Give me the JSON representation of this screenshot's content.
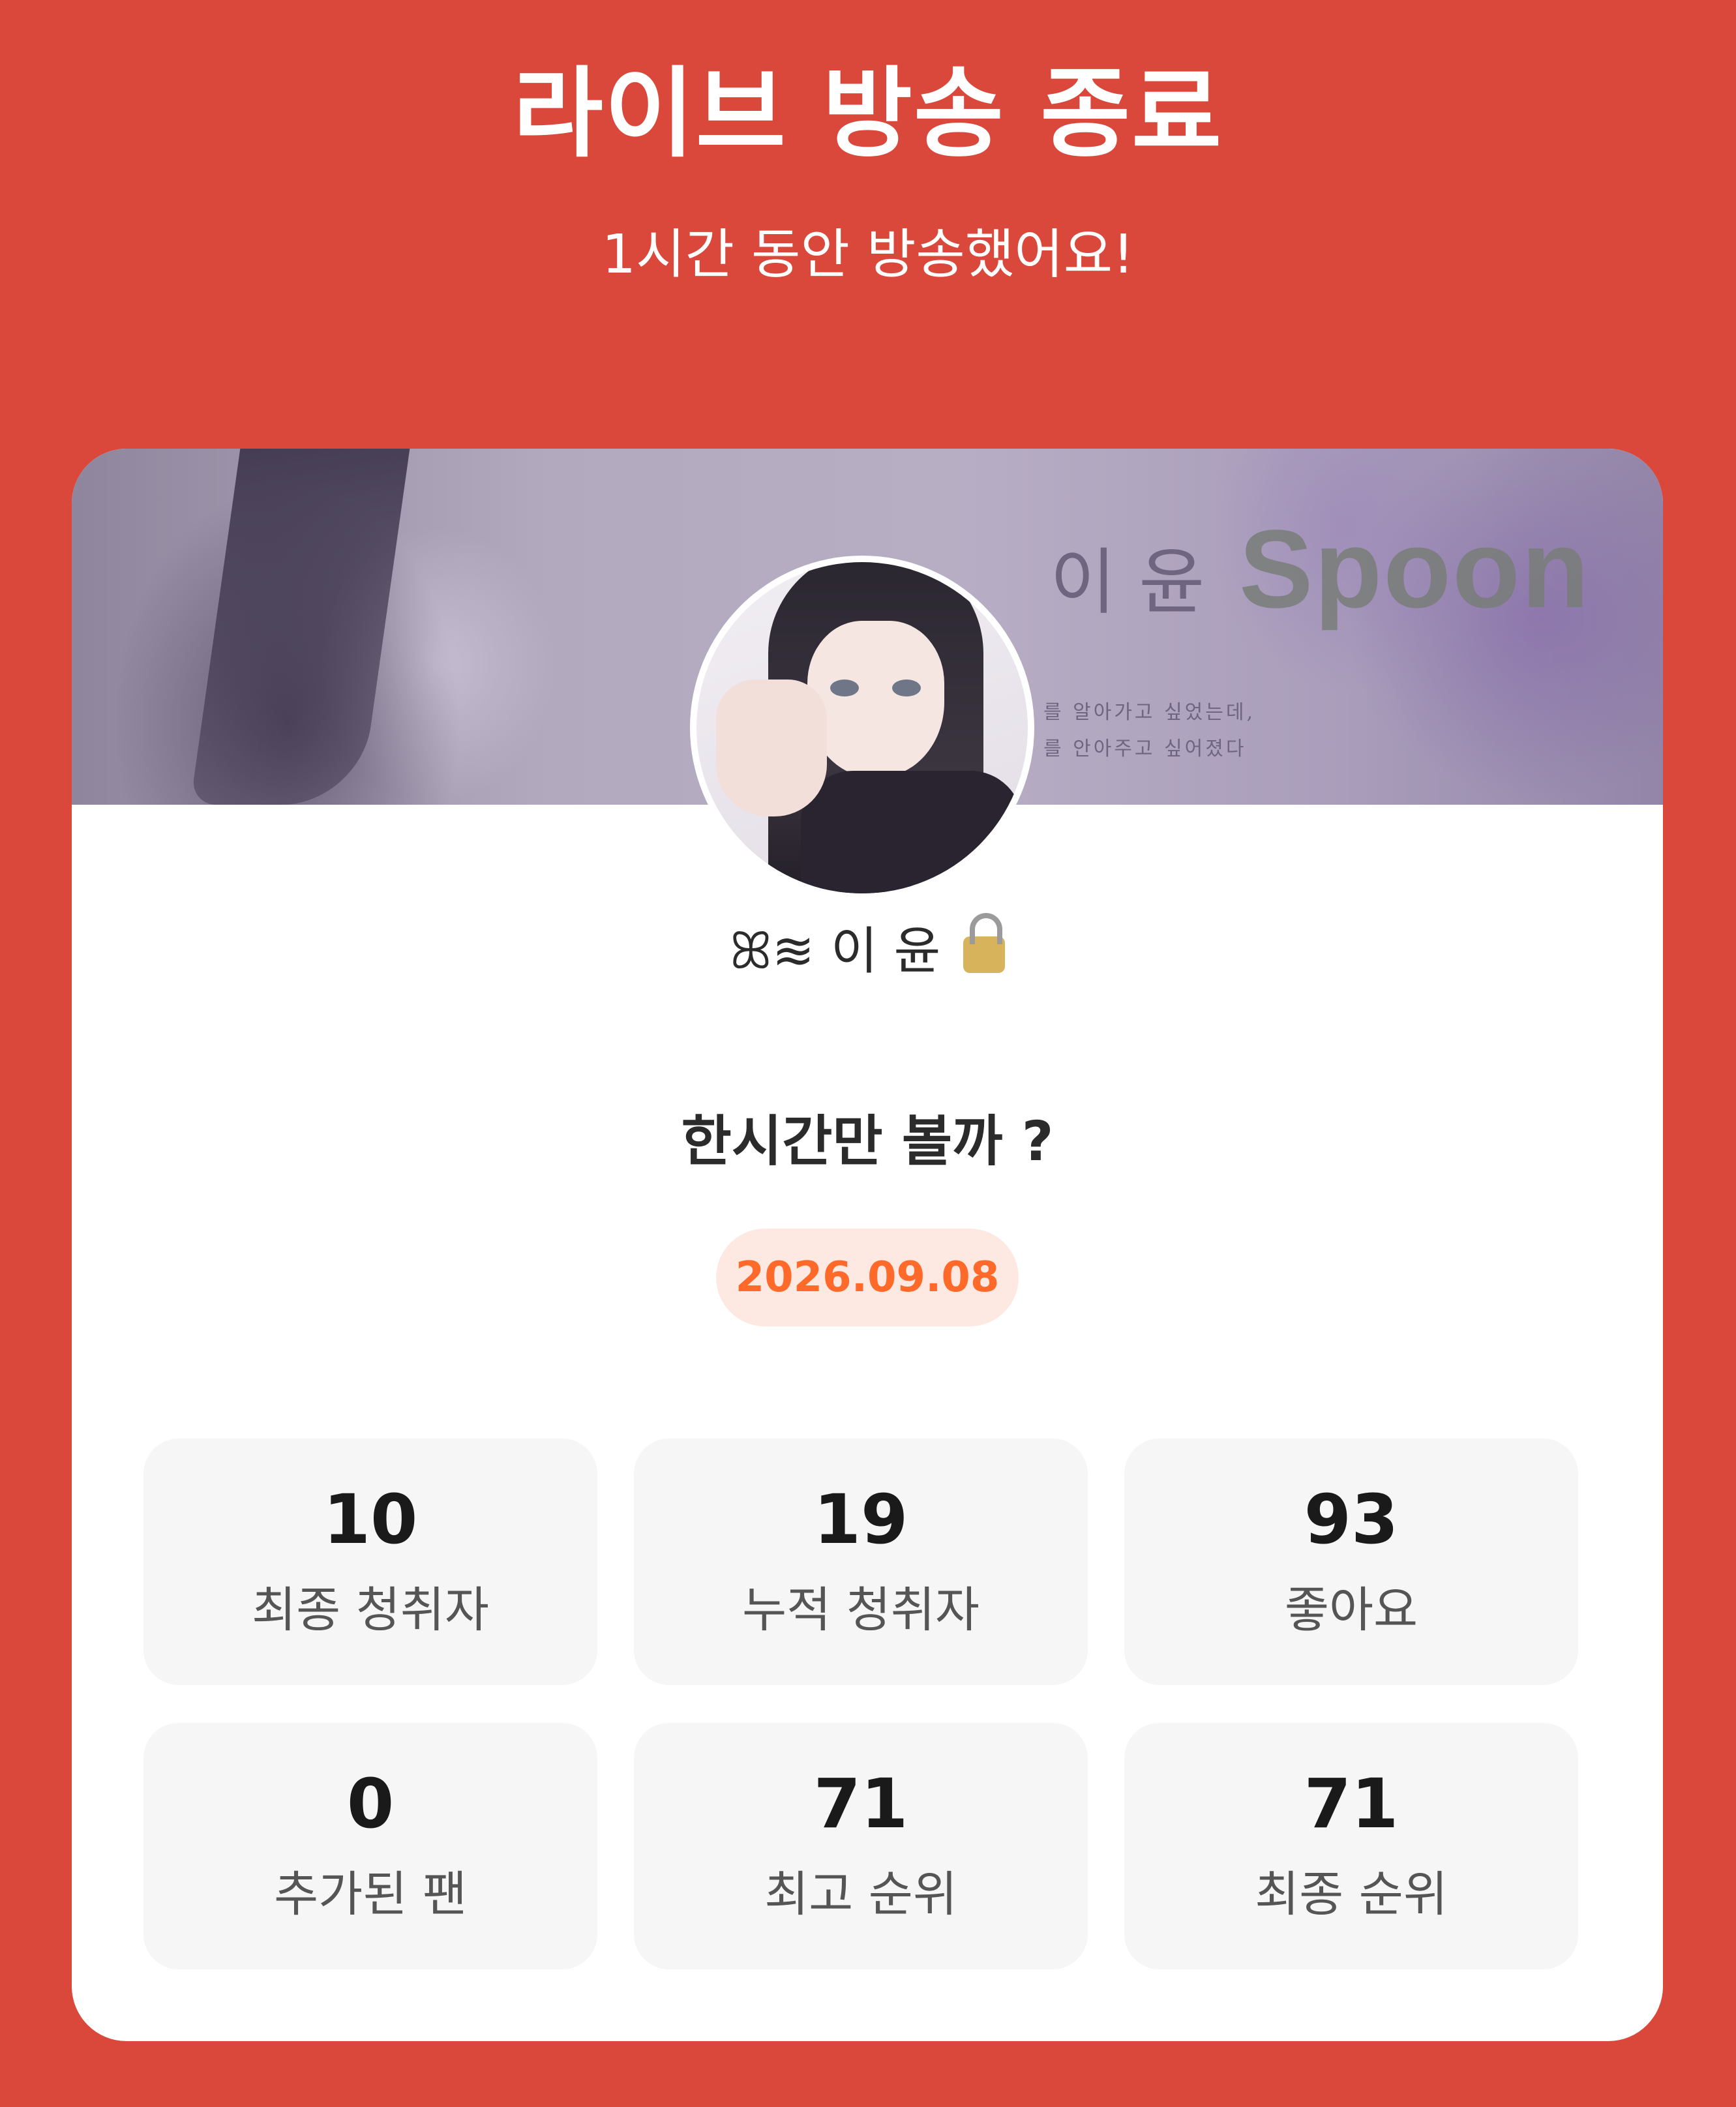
{
  "header": {
    "title": "라이브 방송 종료",
    "subtitle": "1시간 동안 방송했어요!"
  },
  "banner": {
    "name_text": "이 윤",
    "logo_text": "Spoon",
    "quote_line1": "를 알아가고 싶었는데,",
    "quote_line2": "를 안아주고 싶어졌다"
  },
  "profile": {
    "nickname": "ꕤ≋ 이 윤"
  },
  "broadcast": {
    "title": "한시간만 볼까 ?",
    "date": "2026.09.08"
  },
  "stats": [
    {
      "value": "10",
      "label": "최종 청취자"
    },
    {
      "value": "19",
      "label": "누적 청취자"
    },
    {
      "value": "93",
      "label": "좋아요"
    },
    {
      "value": "0",
      "label": "추가된 팬"
    },
    {
      "value": "71",
      "label": "최고 순위"
    },
    {
      "value": "71",
      "label": "최종 순위"
    }
  ],
  "colors": {
    "background": "#d9483b",
    "accent": "#ff6a2b",
    "date_pill_bg": "#fde9e1",
    "stat_bg": "#f6f6f6"
  },
  "icons": {
    "nickname_badge": "lock-with-key-icon"
  }
}
